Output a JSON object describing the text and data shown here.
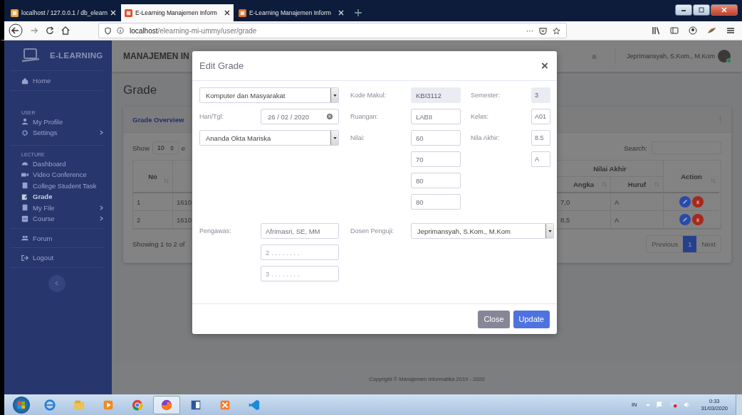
{
  "browser": {
    "tabs": [
      {
        "title": "localhost / 127.0.0.1 / db_elearn",
        "selected": false
      },
      {
        "title": "E-Learning Manajemen Inform",
        "selected": true
      },
      {
        "title": "E-Learning Manajemen Inform",
        "selected": false
      }
    ],
    "url": {
      "host": "localhost",
      "path": "/elearning-mi-ummy/user/grade"
    },
    "more": "···"
  },
  "sidebar": {
    "logo": "E-LEARNING",
    "sections": [
      {
        "items": [
          {
            "label": "Home",
            "selected": false,
            "has_submenu": false
          }
        ]
      },
      {
        "heading": "USER",
        "items": [
          {
            "label": "My Profile",
            "selected": false,
            "has_submenu": false
          },
          {
            "label": "Settings",
            "selected": false,
            "has_submenu": true
          }
        ]
      },
      {
        "heading": "LECTURE",
        "items": [
          {
            "label": "Dashboard",
            "selected": false,
            "has_submenu": false
          },
          {
            "label": "Video Conference",
            "selected": false,
            "has_submenu": false
          },
          {
            "label": "College Student Task",
            "selected": false,
            "has_submenu": false
          },
          {
            "label": "Grade",
            "selected": true,
            "has_submenu": false
          },
          {
            "label": "My File",
            "selected": false,
            "has_submenu": true
          },
          {
            "label": "Course",
            "selected": false,
            "has_submenu": true
          }
        ]
      },
      {
        "items": [
          {
            "label": "Forum",
            "selected": false,
            "has_submenu": false
          }
        ]
      },
      {
        "items": [
          {
            "label": "Logout",
            "selected": false,
            "has_submenu": false
          }
        ]
      }
    ]
  },
  "topbar": {
    "title": "MANAJEMEN IN",
    "user": "Jeprimansyah, S.Kom., M.Kom",
    "online": true
  },
  "page": {
    "title": "Grade",
    "card_title": "Grade Overview",
    "length": {
      "label": "Show",
      "value": "10",
      "suffix": "e"
    },
    "search_label": "Search:",
    "table": {
      "columns": {
        "no": "No",
        "group": "Nilai Akhir",
        "angka": "Angka",
        "huruf": "Huruf",
        "action": "Action"
      },
      "rows": [
        {
          "no": "1",
          "column_2": "1610",
          "angka": "7,0",
          "huruf": "A"
        },
        {
          "no": "2",
          "column_2": "1610",
          "angka": "8,5",
          "huruf": "A"
        }
      ]
    },
    "info": "Showing 1 to 2 of",
    "pagination": [
      {
        "label": "Previous",
        "selected": false
      },
      {
        "label": "1",
        "selected": true
      },
      {
        "label": "Next",
        "selected": false
      }
    ]
  },
  "footer": "Copyright © Manajemen Informatika 2019 - 2020",
  "modal": {
    "title": "Edit Grade",
    "close": "×",
    "course": "Komputer dan Masyarakat",
    "date": {
      "label": "Hari/Tgl:",
      "value": "26 / 02 / 2020"
    },
    "student": "Ananda Okta Mariska",
    "kode_makul": {
      "label": "Kode Makul:",
      "value": "KBI3112",
      "disabled": true
    },
    "ruangan": {
      "label": "Ruangan:",
      "value": "LABII",
      "disabled": false
    },
    "nilai": {
      "label": "Nilai:",
      "values": [
        "60",
        "70",
        "80",
        "80"
      ]
    },
    "semester": {
      "label": "Semester:",
      "value": "3",
      "disabled": true
    },
    "kelas": {
      "label": "Kelas:",
      "value": "A01",
      "disabled": false
    },
    "nilai_akhir": {
      "label": "Nila Akhir:",
      "values": [
        "8.5",
        "A"
      ]
    },
    "pengawas": {
      "label": "Pengawas:",
      "fields": [
        {
          "value": "Afrimasri, SE, MM"
        },
        {
          "placeholder": "2 . . . . . . . ."
        },
        {
          "placeholder": "3 . . . . . . . ."
        }
      ]
    },
    "dosen_penguji": {
      "label": "Dosen Penguji:",
      "value": "Jeprimansyah, S.Kom., M.Kom"
    },
    "buttons": [
      {
        "label": "Close",
        "kind": "secondary"
      },
      {
        "label": "Update",
        "kind": "primary"
      }
    ]
  },
  "taskbar": {
    "apps": [
      {
        "selected": false
      },
      {
        "selected": false
      },
      {
        "selected": false
      },
      {
        "selected": false
      },
      {
        "selected": true
      },
      {
        "selected": false
      },
      {
        "selected": false
      },
      {
        "selected": false
      }
    ],
    "language": "IN",
    "time": "0:33",
    "date": "31/03/2020"
  }
}
